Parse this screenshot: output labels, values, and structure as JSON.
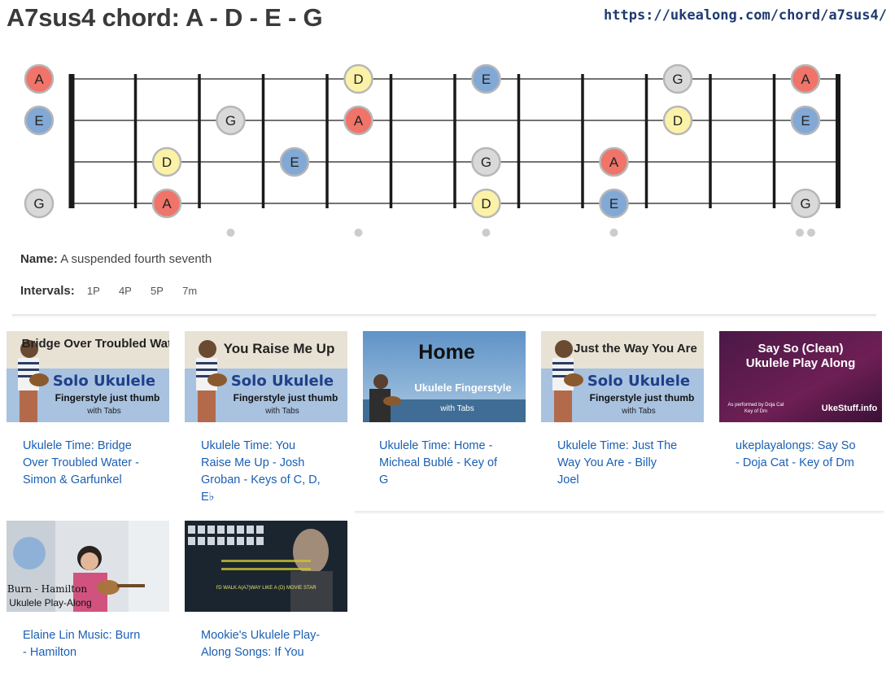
{
  "header": {
    "title": "A7sus4 chord: A - D - E - G",
    "url": "https://ukealong.com/chord/a7sus4/"
  },
  "colors": {
    "A": "#f07469",
    "D": "#fbf2a8",
    "E": "#82a9d6",
    "G": "#d9d9d9",
    "dot_stroke": "#b7b7b7",
    "link": "#1a5fb4"
  },
  "fretboard": {
    "strings": [
      {
        "notes": [
          "A",
          null,
          null,
          null,
          null,
          "D",
          null,
          "E",
          null,
          null,
          "G",
          null,
          "A"
        ]
      },
      {
        "notes": [
          "E",
          null,
          null,
          "G",
          null,
          "A",
          null,
          null,
          null,
          null,
          "D",
          null,
          "E"
        ]
      },
      {
        "notes": [
          null,
          null,
          "D",
          null,
          "E",
          null,
          null,
          "G",
          null,
          "A",
          null,
          null,
          null
        ]
      },
      {
        "notes": [
          "G",
          null,
          "A",
          null,
          null,
          null,
          null,
          "D",
          null,
          "E",
          null,
          null,
          "G"
        ]
      }
    ],
    "fret_markers": [
      3,
      5,
      7,
      9,
      12
    ]
  },
  "chord_info": {
    "name_label": "Name:",
    "name_value": "A suspended fourth seventh",
    "intervals_label": "Intervals:",
    "intervals": [
      "1P",
      "4P",
      "5P",
      "7m"
    ]
  },
  "videos": [
    {
      "caption": "Ukulele Time: Bridge Over Troubled Water - Simon & Garfunkel",
      "thumb_title": "Bridge Over Troubled Water",
      "thumb_sub1": "Solo Ukulele",
      "thumb_sub2": "Fingerstyle just thumb",
      "thumb_sub3": "with Tabs"
    },
    {
      "caption": "Ukulele Time: You Raise Me Up - Josh Groban - Keys of C, D, E♭",
      "thumb_title": "You Raise Me Up",
      "thumb_sub1": "Solo Ukulele",
      "thumb_sub2": "Fingerstyle just thumb",
      "thumb_sub3": "with Tabs"
    },
    {
      "caption": "Ukulele Time: Home - Micheal Bublé - Key of G",
      "thumb_title": "Home",
      "thumb_sub1": "Ukulele Fingerstyle",
      "thumb_sub2": "with Tabs"
    },
    {
      "caption": "Ukulele Time: Just The Way You Are - Billy Joel",
      "thumb_title": "Just the Way You Are",
      "thumb_sub1": "Solo Ukulele",
      "thumb_sub2": "Fingerstyle just thumb",
      "thumb_sub3": "with Tabs"
    },
    {
      "caption": "ukeplayalongs: Say So - Doja Cat - Key of Dm",
      "thumb_title": "Say So (Clean)",
      "thumb_sub1": "Ukulele Play Along",
      "thumb_sub2": "As performed by Doja Cat",
      "thumb_sub3": "Key of Dm",
      "thumb_brand": "UkeStuff.info"
    },
    {
      "caption": "Elaine Lin Music: Burn - Hamilton",
      "thumb_title": "Burn - Hamilton",
      "thumb_sub1": "Ukulele Play-Along"
    },
    {
      "caption": "Mookie's Ukulele Play-Along Songs: If You",
      "thumb_sub1": "I'D WALK A(A7)WAY LIKE A (D) MOVIE STAR"
    }
  ]
}
